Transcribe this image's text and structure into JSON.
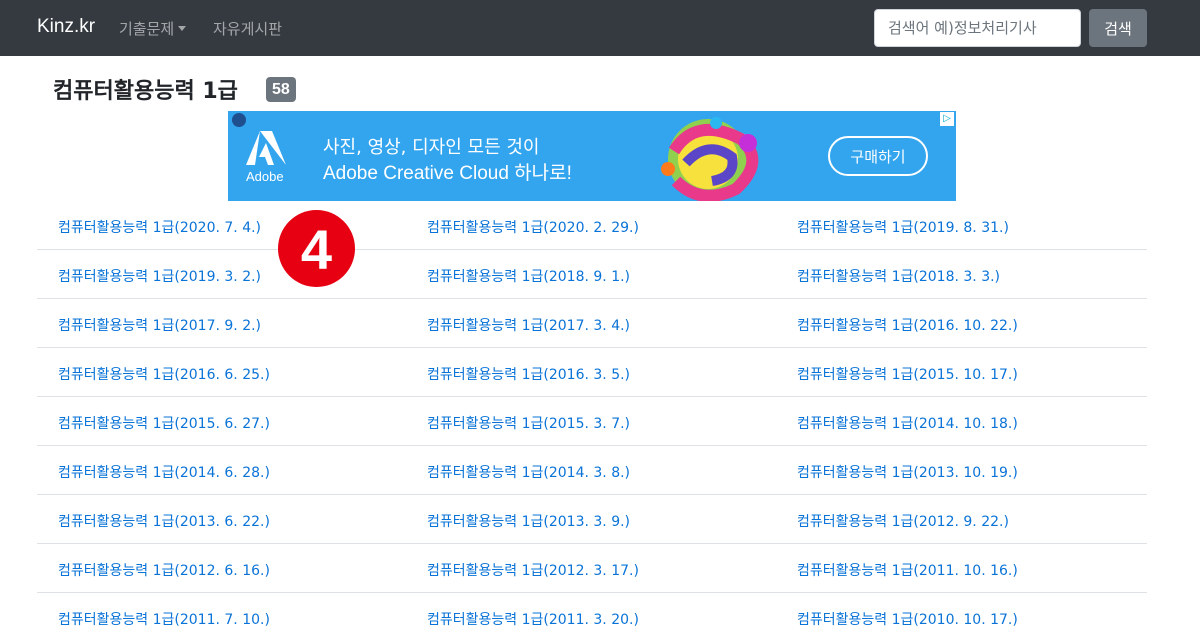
{
  "navbar": {
    "brand": "Kinz.kr",
    "exam_menu_label": "기출문제",
    "board_label": "자유게시판",
    "search_placeholder": "검색어 예)정보처리기사",
    "search_button_label": "검색"
  },
  "page": {
    "title": "컴퓨터활용능력 1급",
    "count_badge": "58"
  },
  "ad": {
    "logo_text": "Adobe",
    "line1": "사진, 영상, 디자인 모든 것이",
    "line2": "Adobe Creative Cloud 하나로!",
    "button_label": "구매하기",
    "colors": {
      "background": "#33a5ef"
    }
  },
  "exams": {
    "rows": [
      [
        "컴퓨터활용능력 1급(2020. 7. 4.)",
        "컴퓨터활용능력 1급(2020. 2. 29.)",
        "컴퓨터활용능력 1급(2019. 8. 31.)"
      ],
      [
        "컴퓨터활용능력 1급(2019. 3. 2.)",
        "컴퓨터활용능력 1급(2018. 9. 1.)",
        "컴퓨터활용능력 1급(2018. 3. 3.)"
      ],
      [
        "컴퓨터활용능력 1급(2017. 9. 2.)",
        "컴퓨터활용능력 1급(2017. 3. 4.)",
        "컴퓨터활용능력 1급(2016. 10. 22.)"
      ],
      [
        "컴퓨터활용능력 1급(2016. 6. 25.)",
        "컴퓨터활용능력 1급(2016. 3. 5.)",
        "컴퓨터활용능력 1급(2015. 10. 17.)"
      ],
      [
        "컴퓨터활용능력 1급(2015. 6. 27.)",
        "컴퓨터활용능력 1급(2015. 3. 7.)",
        "컴퓨터활용능력 1급(2014. 10. 18.)"
      ],
      [
        "컴퓨터활용능력 1급(2014. 6. 28.)",
        "컴퓨터활용능력 1급(2014. 3. 8.)",
        "컴퓨터활용능력 1급(2013. 10. 19.)"
      ],
      [
        "컴퓨터활용능력 1급(2013. 6. 22.)",
        "컴퓨터활용능력 1급(2013. 3. 9.)",
        "컴퓨터활용능력 1급(2012. 9. 22.)"
      ],
      [
        "컴퓨터활용능력 1급(2012. 6. 16.)",
        "컴퓨터활용능력 1급(2012. 3. 17.)",
        "컴퓨터활용능력 1급(2011. 10. 16.)"
      ],
      [
        "컴퓨터활용능력 1급(2011. 7. 10.)",
        "컴퓨터활용능력 1급(2011. 3. 20.)",
        "컴퓨터활용능력 1급(2010. 10. 17.)"
      ]
    ]
  },
  "marker": {
    "label": "4"
  },
  "colors": {
    "navbar": "#343a40",
    "link": "#0a73d7",
    "badge": "#6c757d",
    "marker": "#e60012"
  }
}
